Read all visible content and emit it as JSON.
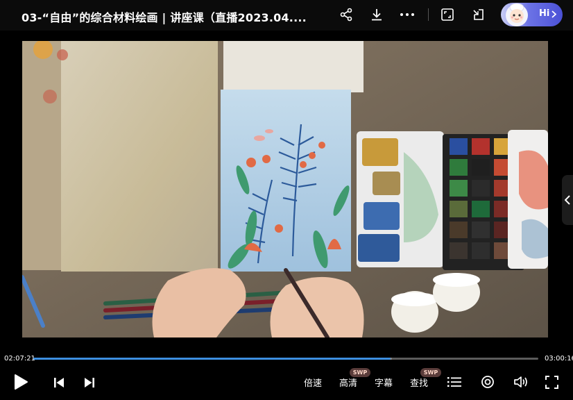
{
  "header": {
    "title": "03-“自由”的综合材料绘画 | 讲座课（直播2023.04....",
    "hi_label": "Hi"
  },
  "player": {
    "current_time": "02:07:21",
    "total_time": "03:00:16",
    "progress": 0.707,
    "buffered": 0.71
  },
  "controls": {
    "speed_label": "倍速",
    "quality_label": "高清",
    "subtitle_label": "字幕",
    "search_label": "查找",
    "swp_badge": "SWP"
  },
  "colors": {
    "accent": "#3d8fe0",
    "badge_bg": "#5a3c3a"
  }
}
